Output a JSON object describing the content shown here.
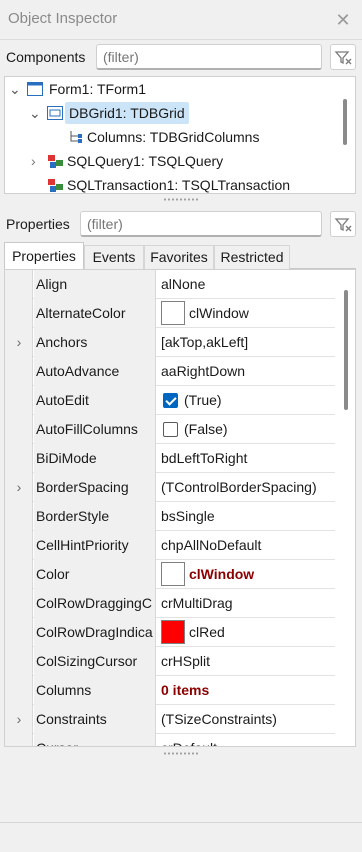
{
  "window": {
    "title": "Object Inspector"
  },
  "components": {
    "label": "Components",
    "filter_placeholder": "(filter)",
    "tree": [
      {
        "label": "Form1: TForm1",
        "expanded": true,
        "icon": "form-icon"
      },
      {
        "label": "DBGrid1: TDBGrid",
        "expanded": true,
        "icon": "grid-icon",
        "selected": true
      },
      {
        "label": "Columns: TDBGridColumns",
        "icon": "columns-icon"
      },
      {
        "label": "SQLQuery1: TSQLQuery",
        "expanded": false,
        "icon": "db-query-icon"
      },
      {
        "label": "SQLTransaction1: TSQLTransaction",
        "icon": "db-transaction-icon"
      }
    ]
  },
  "properties_filter": {
    "label": "Properties",
    "filter_placeholder": "(filter)"
  },
  "tabs": [
    {
      "label": "Properties",
      "active": true
    },
    {
      "label": "Events"
    },
    {
      "label": "Favorites"
    },
    {
      "label": "Restricted"
    }
  ],
  "properties": [
    {
      "name": "Align",
      "value": "alNone"
    },
    {
      "name": "AlternateColor",
      "value": "clWindow",
      "swatch": "#ffffff"
    },
    {
      "name": "Anchors",
      "value": "[akTop,akLeft]",
      "expandable": true
    },
    {
      "name": "AutoAdvance",
      "value": "aaRightDown"
    },
    {
      "name": "AutoEdit",
      "value": "(True)",
      "checkbox": true,
      "checked": true
    },
    {
      "name": "AutoFillColumns",
      "value": "(False)",
      "checkbox": true,
      "checked": false
    },
    {
      "name": "BiDiMode",
      "value": "bdLeftToRight"
    },
    {
      "name": "BorderSpacing",
      "value": "(TControlBorderSpacing)",
      "expandable": true
    },
    {
      "name": "BorderStyle",
      "value": "bsSingle"
    },
    {
      "name": "CellHintPriority",
      "value": "chpAllNoDefault"
    },
    {
      "name": "Color",
      "value": "clWindow",
      "swatch": "#ffffff",
      "highlight": true
    },
    {
      "name": "ColRowDraggingC",
      "value": "crMultiDrag"
    },
    {
      "name": "ColRowDragIndica",
      "value": "clRed",
      "swatch": "#ff0000"
    },
    {
      "name": "ColSizingCursor",
      "value": "crHSplit"
    },
    {
      "name": "Columns",
      "value": "0 items",
      "highlight": true
    },
    {
      "name": "Constraints",
      "value": "(TSizeConstraints)",
      "expandable": true
    },
    {
      "name": "Cursor",
      "value": "crDefault"
    }
  ],
  "colors": {
    "highlight_text": "#8b0000",
    "selection": "#cce4f7",
    "check_accent": "#0067c0"
  }
}
